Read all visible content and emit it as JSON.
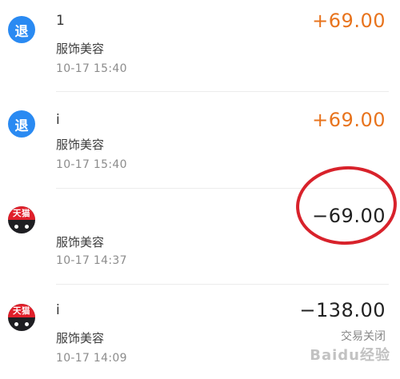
{
  "transactions": [
    {
      "badge": "退",
      "title": "1",
      "category": "服饰美容",
      "time": "10-17  15:40",
      "amount": "+69.00",
      "status": ""
    },
    {
      "badge": "退",
      "title": "i",
      "category": "服饰美容",
      "time": "10-17  15:40",
      "amount": "+69.00",
      "status": ""
    },
    {
      "badge": "天猫",
      "title": "",
      "category": "服饰美容",
      "time": "10-17  14:37",
      "amount": "−69.00",
      "status": ""
    },
    {
      "badge": "天猫",
      "title": "i",
      "category": "服饰美容",
      "time": "10-17  14:09",
      "amount": "−138.00",
      "status": "交易关闭"
    }
  ],
  "watermark": "Baidu经验",
  "colors": {
    "refund_badge": "#2a8af2",
    "tmall_red": "#e01f2a",
    "positive_amount": "#e8741e",
    "negative_amount": "#222222",
    "annotation_circle": "#d8222b"
  }
}
